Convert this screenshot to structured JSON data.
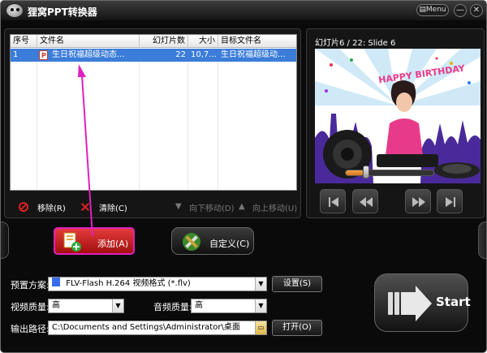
{
  "app": {
    "title": "狸窝PPT转换器",
    "menu_label": "Menu",
    "min_label": "—",
    "close_label": "✕"
  },
  "table": {
    "columns": [
      "序号",
      "文件名",
      "幻灯片数",
      "大小",
      "目标文件名"
    ],
    "rows": [
      {
        "index": "1",
        "file": "生日祝福超级动态...",
        "slides": "22",
        "size": "10,7...",
        "target": "生日祝福超级动..."
      }
    ]
  },
  "list_toolbar": {
    "remove": "移除(R)",
    "clear": "清除(C)",
    "move_down": "向下移动(D)",
    "move_up": "向上移动(U)"
  },
  "preview": {
    "label": "幻灯片6 / 22: Slide 6",
    "slide_text": "HAPPY BIRTHDAY",
    "seek_progress": 0.2
  },
  "actions": {
    "add": "添加(A)",
    "custom": "自定义(C)"
  },
  "settings": {
    "preset_label": "预置方案:",
    "preset_value": "FLV-Flash H.264 视频格式 (*.flv)",
    "preset_button": "设置(S)",
    "video_quality_label": "视频质量:",
    "video_quality_value": "高",
    "audio_quality_label": "音频质量:",
    "audio_quality_value": "高",
    "output_label": "输出路径:",
    "output_value": "C:\\Documents and Settings\\Administrator\\桌面",
    "open_button": "打开(O)",
    "start": "Start"
  },
  "colors": {
    "selection": "#3b7dd8",
    "add_button": "#c8151a",
    "highlight_border": "#e020c0",
    "seek_fill": "#e8902c"
  }
}
